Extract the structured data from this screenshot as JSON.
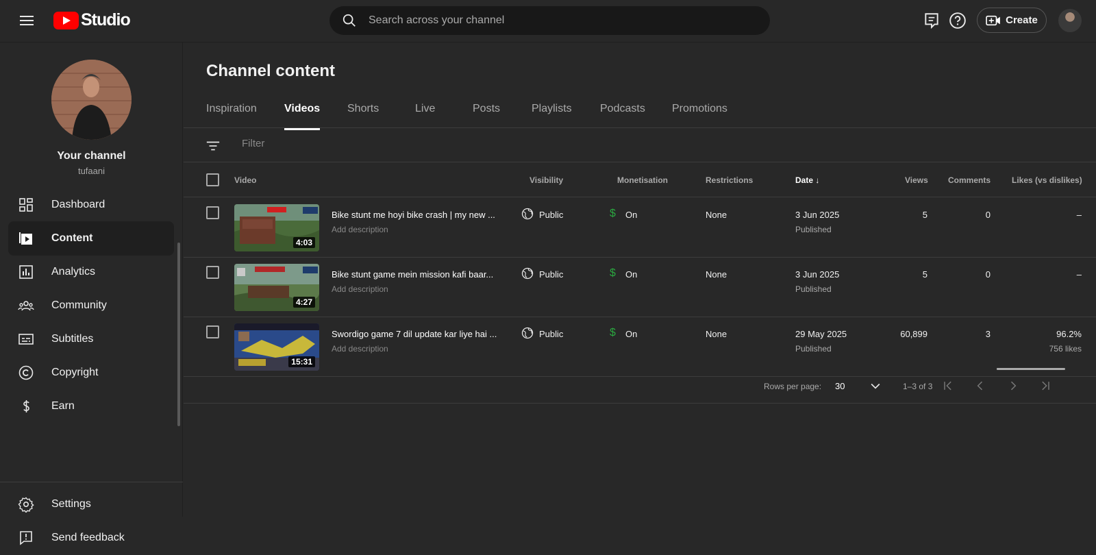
{
  "header": {
    "logo_text": "Studio",
    "search_placeholder": "Search across your channel",
    "create_label": "Create"
  },
  "sidebar": {
    "channel_name": "Your channel",
    "channel_handle": "tufaani",
    "items": [
      {
        "label": "Dashboard",
        "icon": "dashboard-icon"
      },
      {
        "label": "Content",
        "icon": "content-icon",
        "active": true
      },
      {
        "label": "Analytics",
        "icon": "analytics-icon"
      },
      {
        "label": "Community",
        "icon": "community-icon"
      },
      {
        "label": "Subtitles",
        "icon": "subtitles-icon"
      },
      {
        "label": "Copyright",
        "icon": "copyright-icon"
      },
      {
        "label": "Earn",
        "icon": "dollar-icon"
      },
      {
        "label": "Settings",
        "icon": "gear-icon"
      },
      {
        "label": "Send feedback",
        "icon": "feedback-icon"
      }
    ]
  },
  "main": {
    "title": "Channel content",
    "tabs": [
      "Inspiration",
      "Videos",
      "Shorts",
      "Live",
      "Posts",
      "Playlists",
      "Podcasts",
      "Promotions"
    ],
    "active_tab": "Videos",
    "filter_placeholder": "Filter",
    "columns": {
      "video": "Video",
      "visibility": "Visibility",
      "monetisation": "Monetisation",
      "restrictions": "Restrictions",
      "date": "Date",
      "views": "Views",
      "comments": "Comments",
      "likes": "Likes (vs dislikes)"
    },
    "rows": [
      {
        "title": "Bike stunt me hoyi bike crash | my new ...",
        "description": "Add description",
        "duration": "4:03",
        "visibility": "Public",
        "monetisation": "On",
        "restrictions": "None",
        "date": "3 Jun 2025",
        "status": "Published",
        "views": "5",
        "comments": "0",
        "likes": "–",
        "likes_sub": ""
      },
      {
        "title": "Bike stunt game mein mission kafi baar...",
        "description": "Add description",
        "duration": "4:27",
        "visibility": "Public",
        "monetisation": "On",
        "restrictions": "None",
        "date": "3 Jun 2025",
        "status": "Published",
        "views": "5",
        "comments": "0",
        "likes": "–",
        "likes_sub": ""
      },
      {
        "title": "Swordigo game 7 dil update kar liye hai ...",
        "description": "Add description",
        "duration": "15:31",
        "visibility": "Public",
        "monetisation": "On",
        "restrictions": "None",
        "date": "29 May 2025",
        "status": "Published",
        "views": "60,899",
        "comments": "3",
        "likes": "96.2%",
        "likes_sub": "756 likes",
        "likes_ratio": 0.962
      }
    ],
    "pagination": {
      "rows_per_page_label": "Rows per page:",
      "rows_per_page": "30",
      "range": "1–3 of 3"
    }
  },
  "colors": {
    "background": "#282828",
    "accent_red": "#ff0000",
    "monetisation_green": "#2ba640"
  }
}
